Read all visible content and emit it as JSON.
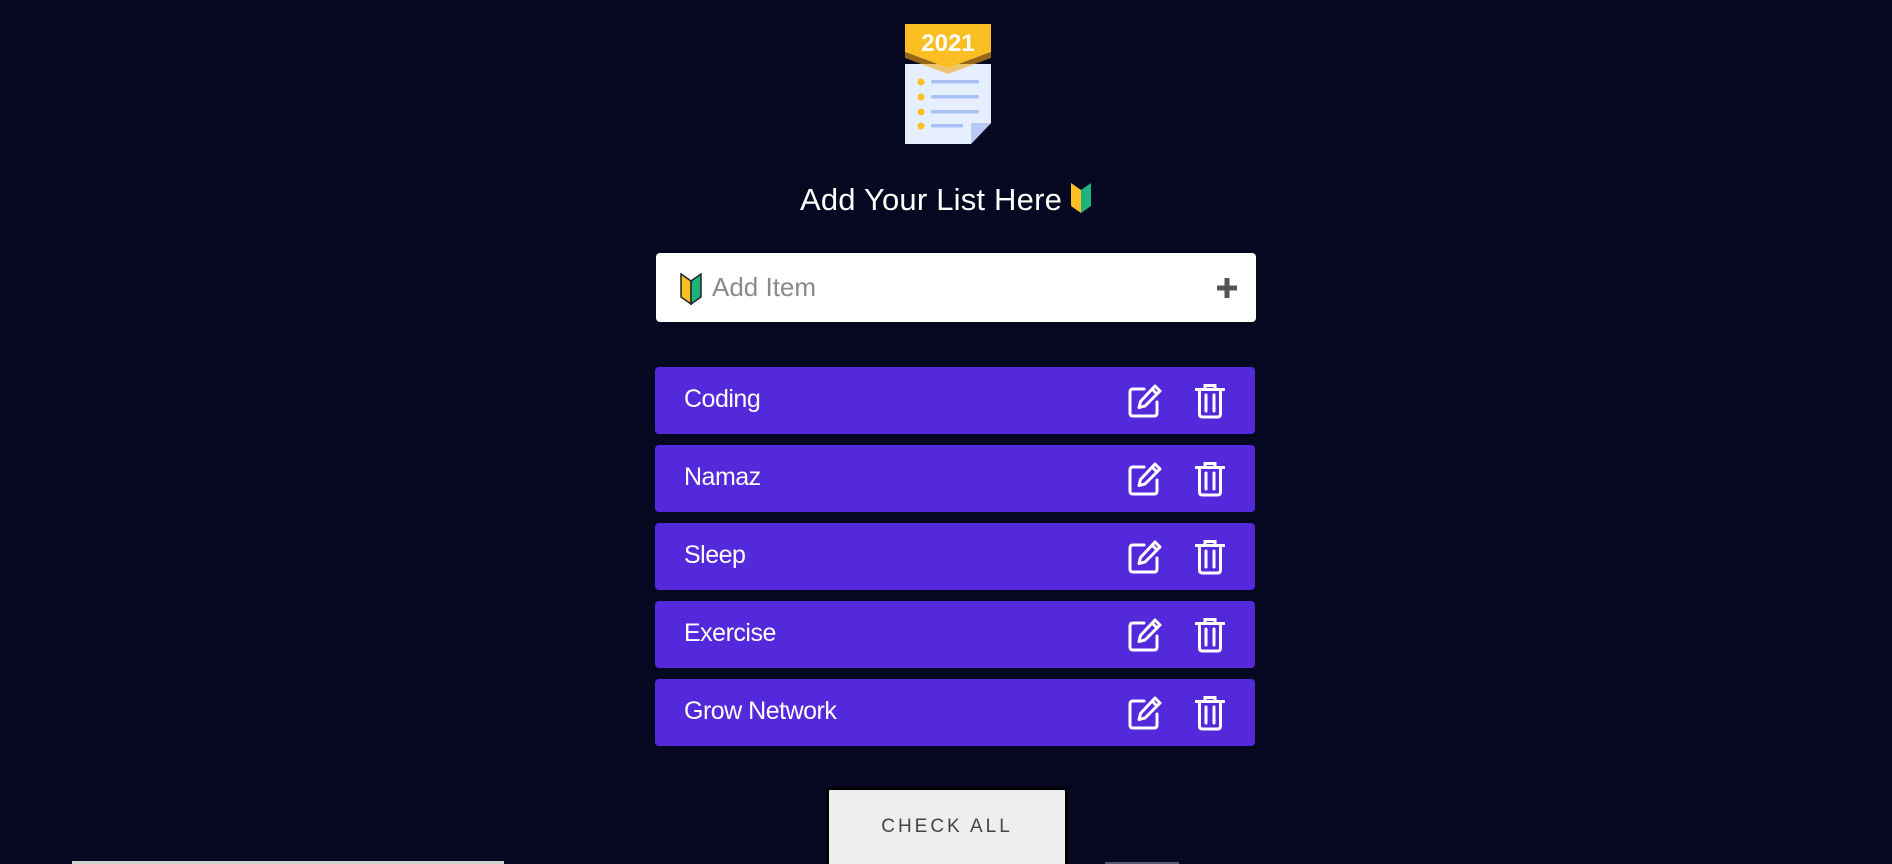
{
  "logo": {
    "icon": "checklist-2021-icon",
    "year_label": "2021"
  },
  "heading": {
    "text": "Add Your List Here",
    "icon": "beginner-icon"
  },
  "add_item": {
    "icon": "beginner-icon",
    "placeholder": "Add Item",
    "value": "",
    "add_button_icon": "plus-icon"
  },
  "items": [
    {
      "label": "Coding"
    },
    {
      "label": "Namaz"
    },
    {
      "label": "Sleep"
    },
    {
      "label": "Exercise"
    },
    {
      "label": "Grow Network"
    }
  ],
  "item_actions": {
    "edit_icon": "edit-icon",
    "delete_icon": "trash-icon"
  },
  "check_all": {
    "label": "CHECK ALL"
  },
  "colors": {
    "background": "#060822",
    "item_background": "#5429db",
    "input_background": "#ffffff",
    "button_background": "#eeeeee",
    "logo_accent": "#fbbf24"
  }
}
